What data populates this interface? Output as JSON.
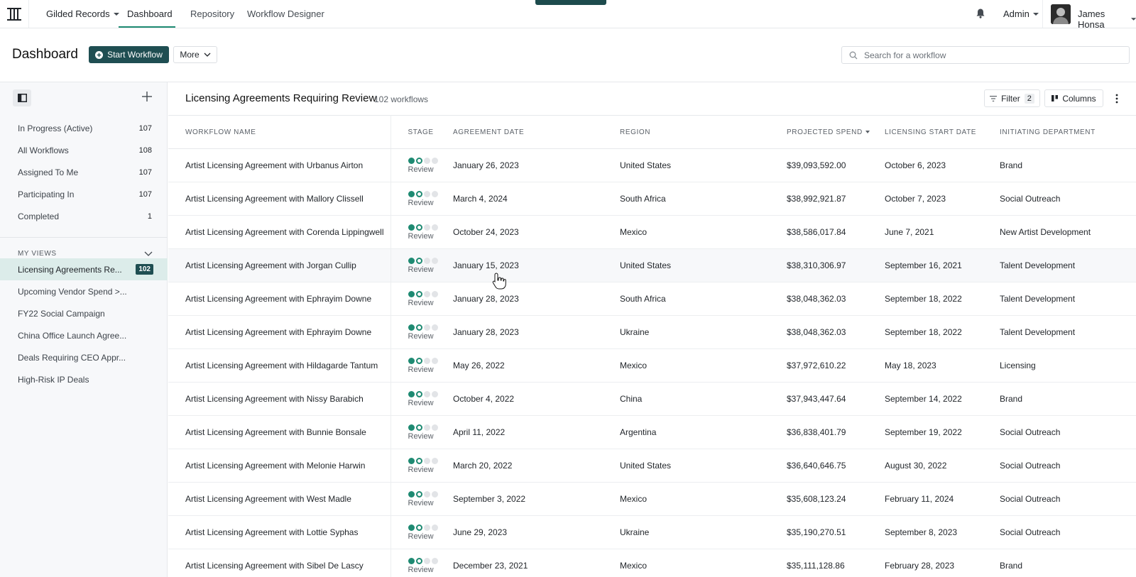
{
  "nav": {
    "org_name": "Gilded Records",
    "tabs": [
      {
        "label": "Dashboard"
      },
      {
        "label": "Repository"
      },
      {
        "label": "Workflow Designer"
      }
    ],
    "role": "Admin",
    "user_name": "James Honsa"
  },
  "header": {
    "title": "Dashboard",
    "start_button": "Start Workflow",
    "more_button": "More",
    "search_placeholder": "Search for a workflow"
  },
  "sidebar": {
    "items": [
      {
        "label": "In Progress (Active)",
        "count": "107"
      },
      {
        "label": "All Workflows",
        "count": "108"
      },
      {
        "label": "Assigned To Me",
        "count": "107"
      },
      {
        "label": "Participating In",
        "count": "107"
      },
      {
        "label": "Completed",
        "count": "1"
      }
    ],
    "views_heading": "MY VIEWS",
    "views": [
      {
        "label": "Licensing Agreements Re...",
        "count": "102"
      },
      {
        "label": "Upcoming Vendor Spend >..."
      },
      {
        "label": "FY22 Social Campaign"
      },
      {
        "label": "China Office Launch Agree..."
      },
      {
        "label": "Deals Requiring CEO Appr..."
      },
      {
        "label": "High-Risk IP Deals"
      }
    ]
  },
  "list": {
    "title": "Licensing Agreements Requiring Review",
    "count_text": "102 workflows",
    "filter_label": "Filter",
    "filter_count": "2",
    "columns_label": "Columns",
    "columns": [
      "WORKFLOW NAME",
      "STAGE",
      "AGREEMENT DATE",
      "REGION",
      "PROJECTED SPEND",
      "LICENSING START DATE",
      "INITIATING DEPARTMENT"
    ],
    "rows": [
      {
        "name": "Artist Licensing Agreement with Urbanus Airton",
        "stage": "Review",
        "agreement_date": "January 26, 2023",
        "region": "United States",
        "spend": "$39,093,592.00",
        "start_date": "October 6, 2023",
        "department": "Brand"
      },
      {
        "name": "Artist Licensing Agreement with Mallory Clissell",
        "stage": "Review",
        "agreement_date": "March 4, 2024",
        "region": "South Africa",
        "spend": "$38,992,921.87",
        "start_date": "October 7, 2023",
        "department": "Social Outreach"
      },
      {
        "name": "Artist Licensing Agreement with Corenda Lippingwell",
        "stage": "Review",
        "agreement_date": "October 24, 2023",
        "region": "Mexico",
        "spend": "$38,586,017.84",
        "start_date": "June 7, 2021",
        "department": "New Artist Development"
      },
      {
        "name": "Artist Licensing Agreement with Jorgan Cullip",
        "stage": "Review",
        "agreement_date": "January 15, 2023",
        "region": "United States",
        "spend": "$38,310,306.97",
        "start_date": "September 16, 2021",
        "department": "Talent Development"
      },
      {
        "name": "Artist Licensing Agreement with Ephrayim Downe",
        "stage": "Review",
        "agreement_date": "January 28, 2023",
        "region": "South Africa",
        "spend": "$38,048,362.03",
        "start_date": "September 18, 2022",
        "department": "Talent Development"
      },
      {
        "name": "Artist Licensing Agreement with Ephrayim Downe",
        "stage": "Review",
        "agreement_date": "January 28, 2023",
        "region": "Ukraine",
        "spend": "$38,048,362.03",
        "start_date": "September 18, 2022",
        "department": "Talent Development"
      },
      {
        "name": "Artist Licensing Agreement with Hildagarde Tantum",
        "stage": "Review",
        "agreement_date": "May 26, 2022",
        "region": "Mexico",
        "spend": "$37,972,610.22",
        "start_date": "May 18, 2023",
        "department": "Licensing"
      },
      {
        "name": "Artist Licensing Agreement with Nissy Barabich",
        "stage": "Review",
        "agreement_date": "October 4, 2022",
        "region": "China",
        "spend": "$37,943,447.64",
        "start_date": "September 14, 2022",
        "department": "Brand"
      },
      {
        "name": "Artist Licensing Agreement with Bunnie Bonsale",
        "stage": "Review",
        "agreement_date": "April 11, 2022",
        "region": "Argentina",
        "spend": "$36,838,401.79",
        "start_date": "September 19, 2022",
        "department": "Social Outreach"
      },
      {
        "name": "Artist Licensing Agreement with Melonie Harwin",
        "stage": "Review",
        "agreement_date": "March 20, 2022",
        "region": "United States",
        "spend": "$36,640,646.75",
        "start_date": "August 30, 2022",
        "department": "Social Outreach"
      },
      {
        "name": "Artist Licensing Agreement with West Madle",
        "stage": "Review",
        "agreement_date": "September 3, 2022",
        "region": "Mexico",
        "spend": "$35,608,123.24",
        "start_date": "February 11, 2024",
        "department": "Social Outreach"
      },
      {
        "name": "Artist Licensing Agreement with Lottie Syphas",
        "stage": "Review",
        "agreement_date": "June 29, 2023",
        "region": "Ukraine",
        "spend": "$35,190,270.51",
        "start_date": "September 8, 2023",
        "department": "Social Outreach"
      },
      {
        "name": "Artist Licensing Agreement with Sibel De Lascy",
        "stage": "Review",
        "agreement_date": "December 23, 2021",
        "region": "Mexico",
        "spend": "$35,111,128.86",
        "start_date": "February 28, 2023",
        "department": "Brand"
      }
    ]
  },
  "colors": {
    "brand": "#1f4e52",
    "accent": "#1e8a72",
    "active_view_bg": "#dcecea"
  }
}
